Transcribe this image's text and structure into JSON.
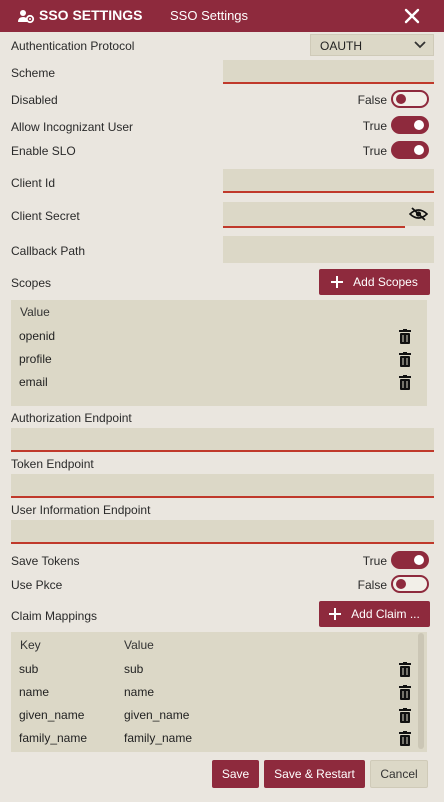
{
  "header": {
    "title": "SSO SETTINGS",
    "subtitle": "SSO Settings"
  },
  "fields": {
    "auth_protocol_label": "Authentication Protocol",
    "auth_protocol_value": "OAUTH",
    "scheme_label": "Scheme",
    "disabled_label": "Disabled",
    "disabled_value": "False",
    "allow_incog_label": "Allow Incognizant User",
    "allow_incog_value": "True",
    "enable_slo_label": "Enable SLO",
    "enable_slo_value": "True",
    "client_id_label": "Client Id",
    "client_secret_label": "Client Secret",
    "callback_label": "Callback Path",
    "scopes_label": "Scopes",
    "add_scopes": "Add Scopes",
    "auth_endpoint_label": "Authorization Endpoint",
    "token_endpoint_label": "Token Endpoint",
    "userinfo_endpoint_label": "User Information Endpoint",
    "save_tokens_label": "Save Tokens",
    "save_tokens_value": "True",
    "use_pkce_label": "Use Pkce",
    "use_pkce_value": "False",
    "claim_label": "Claim Mappings",
    "add_claim": "Add Claim ..."
  },
  "scopes": {
    "header": "Value",
    "items": [
      "openid",
      "profile",
      "email"
    ]
  },
  "claims": {
    "key_header": "Key",
    "value_header": "Value",
    "rows": [
      {
        "key": "sub",
        "value": "sub"
      },
      {
        "key": "name",
        "value": "name"
      },
      {
        "key": "given_name",
        "value": "given_name"
      },
      {
        "key": "family_name",
        "value": "family_name"
      }
    ]
  },
  "footer": {
    "save": "Save",
    "save_restart": "Save & Restart",
    "cancel": "Cancel"
  },
  "colors": {
    "accent": "#8e2a3d",
    "error_underline": "#c0392b",
    "field_bg": "#dcd8c7",
    "page_bg": "#eae6df"
  }
}
